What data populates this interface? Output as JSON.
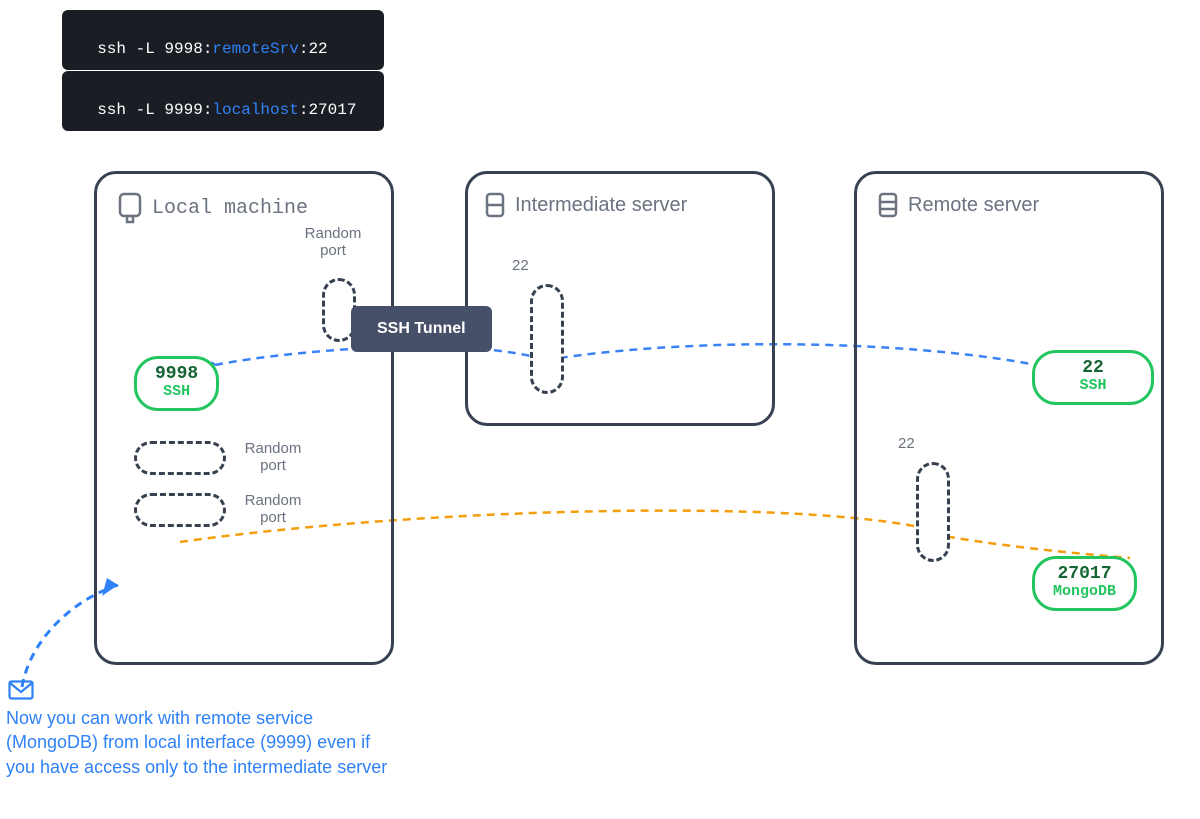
{
  "commands": {
    "cmd1_prefix": "ssh -L 9998:",
    "cmd1_host": "remoteSrv",
    "cmd1_suffix": ":22",
    "cmd2_prefix": "ssh -L 9999:",
    "cmd2_host": "localhost",
    "cmd2_suffix": ":27017"
  },
  "boxes": {
    "local_title": "Local machine",
    "inter_title": "Intermediate server",
    "remote_title": "Remote server"
  },
  "labels": {
    "random_port": "Random port",
    "ssh_tunnel": "SSH Tunnel",
    "port_22": "22"
  },
  "ports": {
    "local_ssh_num": "9998",
    "local_ssh_lbl": "SSH",
    "remote_ssh_num": "22",
    "remote_ssh_lbl": "SSH",
    "remote_mongo_num": "27017",
    "remote_mongo_lbl": "MongoDB"
  },
  "note": "Now you can work with remote service (MongoDB) from local interface (9999) even if you have access only to the intermediate server"
}
